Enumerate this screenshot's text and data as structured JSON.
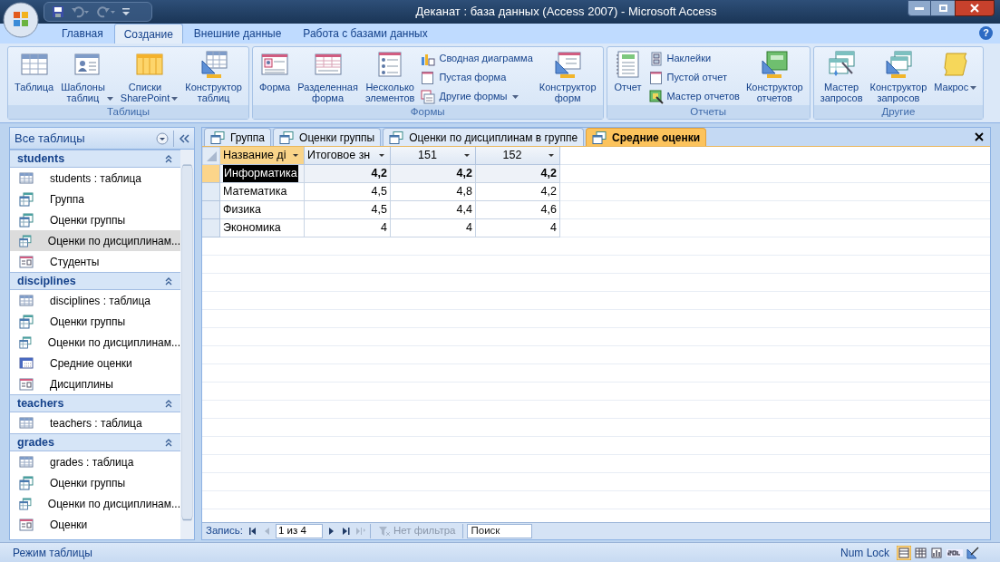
{
  "window": {
    "title": "Деканат : база данных (Access 2007)  -  Microsoft Access"
  },
  "help": "?",
  "ribbon": {
    "tabs": [
      {
        "label": "Главная",
        "selected": false
      },
      {
        "label": "Создание",
        "selected": true
      },
      {
        "label": "Внешние данные",
        "selected": false
      },
      {
        "label": "Работа с базами данных",
        "selected": false
      }
    ],
    "groups": [
      {
        "label": "Таблицы",
        "items": [
          {
            "kind": "large",
            "label": "Таблица",
            "dropdown": false
          },
          {
            "kind": "large",
            "label": "Шаблоны таблиц",
            "dropdown": true
          },
          {
            "kind": "large",
            "label": "Списки SharePoint",
            "dropdown": true
          },
          {
            "kind": "large",
            "label": "Конструктор таблиц",
            "dropdown": false
          }
        ]
      },
      {
        "label": "Формы",
        "items": [
          {
            "kind": "large",
            "label": "Форма",
            "dropdown": false
          },
          {
            "kind": "large",
            "label": "Разделенная форма",
            "dropdown": false
          },
          {
            "kind": "large",
            "label": "Несколько элементов",
            "dropdown": false
          },
          {
            "kind": "stack",
            "items": [
              {
                "label": "Сводная диаграмма",
                "dropdown": false
              },
              {
                "label": "Пустая форма",
                "dropdown": false
              },
              {
                "label": "Другие формы",
                "dropdown": true
              }
            ]
          },
          {
            "kind": "large",
            "label": "Конструктор форм",
            "dropdown": false
          }
        ]
      },
      {
        "label": "Отчеты",
        "items": [
          {
            "kind": "large",
            "label": "Отчет",
            "dropdown": false
          },
          {
            "kind": "stack",
            "items": [
              {
                "label": "Наклейки",
                "dropdown": false
              },
              {
                "label": "Пустой отчет",
                "dropdown": false
              },
              {
                "label": "Мастер отчетов",
                "dropdown": false
              }
            ]
          },
          {
            "kind": "large",
            "label": "Конструктор отчетов",
            "dropdown": false
          }
        ]
      },
      {
        "label": "Другие",
        "items": [
          {
            "kind": "large",
            "label": "Мастер запросов",
            "dropdown": false
          },
          {
            "kind": "large",
            "label": "Конструктор запросов",
            "dropdown": false
          },
          {
            "kind": "large",
            "label": "Макрос",
            "dropdown": true
          }
        ]
      }
    ]
  },
  "nav": {
    "header": "Все таблицы",
    "groups": [
      {
        "title": "students",
        "expanded": true,
        "items": [
          {
            "kind": "table",
            "label": "students : таблица",
            "selected": false
          },
          {
            "kind": "query",
            "label": "Группа",
            "selected": false
          },
          {
            "kind": "query",
            "label": "Оценки группы",
            "selected": false
          },
          {
            "kind": "query",
            "label": "Оценки по дисциплинам...",
            "selected": true
          },
          {
            "kind": "form",
            "label": "Студенты",
            "selected": false
          }
        ]
      },
      {
        "title": "disciplines",
        "expanded": true,
        "items": [
          {
            "kind": "table",
            "label": "disciplines : таблица",
            "selected": false
          },
          {
            "kind": "query",
            "label": "Оценки группы",
            "selected": false
          },
          {
            "kind": "query",
            "label": "Оценки по дисциплинам...",
            "selected": false
          },
          {
            "kind": "crosstab",
            "label": "Средние оценки",
            "selected": false
          },
          {
            "kind": "form",
            "label": "Дисциплины",
            "selected": false
          }
        ]
      },
      {
        "title": "teachers",
        "expanded": true,
        "items": [
          {
            "kind": "table",
            "label": "teachers : таблица",
            "selected": false
          }
        ]
      },
      {
        "title": "grades",
        "expanded": true,
        "items": [
          {
            "kind": "table",
            "label": "grades : таблица",
            "selected": false
          },
          {
            "kind": "query",
            "label": "Оценки группы",
            "selected": false
          },
          {
            "kind": "query",
            "label": "Оценки по дисциплинам...",
            "selected": false
          },
          {
            "kind": "form",
            "label": "Оценки",
            "selected": false
          }
        ]
      }
    ]
  },
  "doc_tabs": [
    {
      "label": "Группа",
      "selected": false
    },
    {
      "label": "Оценки группы",
      "selected": false
    },
    {
      "label": "Оценки по дисциплинам в группе",
      "selected": false
    },
    {
      "label": "Средние оценки",
      "selected": true
    }
  ],
  "datasheet": {
    "columns": [
      {
        "label": "Название ді"
      },
      {
        "label": "Итоговое зн"
      },
      {
        "label": "151"
      },
      {
        "label": "152"
      }
    ],
    "rows": [
      {
        "selected": true,
        "cells": [
          "Информатика",
          "4,2",
          "4,2",
          "4,2"
        ]
      },
      {
        "selected": false,
        "cells": [
          "Математика",
          "4,5",
          "4,8",
          "4,2"
        ]
      },
      {
        "selected": false,
        "cells": [
          "Физика",
          "4,5",
          "4,4",
          "4,6"
        ]
      },
      {
        "selected": false,
        "cells": [
          "Экономика",
          "4",
          "4",
          "4"
        ]
      }
    ]
  },
  "record_nav": {
    "label": "Запись:",
    "position": "1 из 4",
    "filter": "Нет фильтра",
    "filter_disabled": true,
    "search_placeholder": "Поиск"
  },
  "status_bar": {
    "mode": "Режим таблицы",
    "num_lock": "Num Lock"
  }
}
